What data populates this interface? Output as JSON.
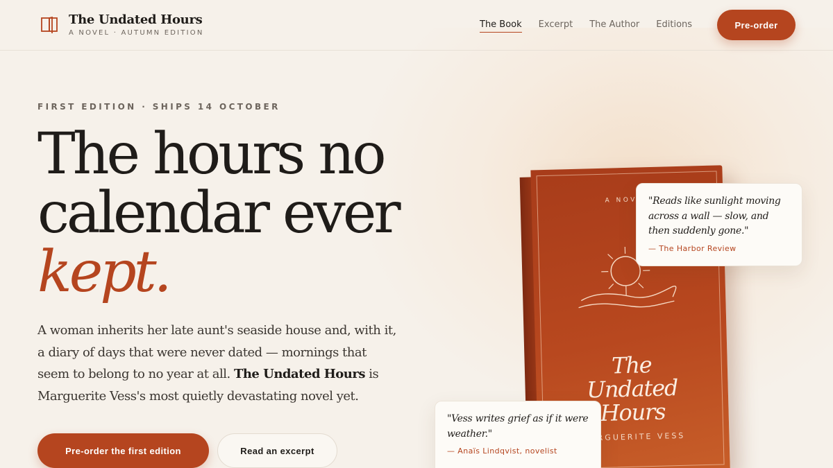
{
  "brand": {
    "title": "The Undated Hours",
    "subtitle": "A NOVEL · AUTUMN EDITION",
    "icon": "open-book-icon"
  },
  "nav": {
    "items": [
      {
        "label": "The Book",
        "active": true
      },
      {
        "label": "Excerpt",
        "active": false
      },
      {
        "label": "The Author",
        "active": false
      },
      {
        "label": "Editions",
        "active": false
      }
    ],
    "cta": "Pre-order"
  },
  "hero": {
    "eyebrow": "FIRST EDITION · SHIPS 14 OCTOBER",
    "headline_line1": "The hours no",
    "headline_line2": "calendar ever",
    "headline_accent": "kept.",
    "lede_before": "A woman inherits her late aunt's seaside house and, with it, a diary of days that were never dated — mornings that seem to belong to no year at all. ",
    "lede_strong": "The Undated Hours",
    "lede_after": " is Marguerite Vess's most quietly devastating novel yet.",
    "primary_button": "Pre-order the first edition",
    "secondary_button": "Read an excerpt"
  },
  "book_cover": {
    "eyebrow": "A NOVEL",
    "title_line1": "The",
    "title_line2": "Undated",
    "title_line3": "Hours",
    "author": "MARGUERITE VESS",
    "art": "sun-over-waves-icon"
  },
  "quotes": [
    {
      "text": "\"Reads like sunlight moving across a wall — slow, and then suddenly gone.\"",
      "source": "— The Harbor Review"
    },
    {
      "text": "\"Vess writes grief as if it were weather.\"",
      "source": "— Anaïs Lindqvist, novelist"
    }
  ],
  "colors": {
    "accent": "#b5451f",
    "background": "#f6f1ea",
    "ink": "#1f1c19",
    "muted": "#6d655d"
  }
}
